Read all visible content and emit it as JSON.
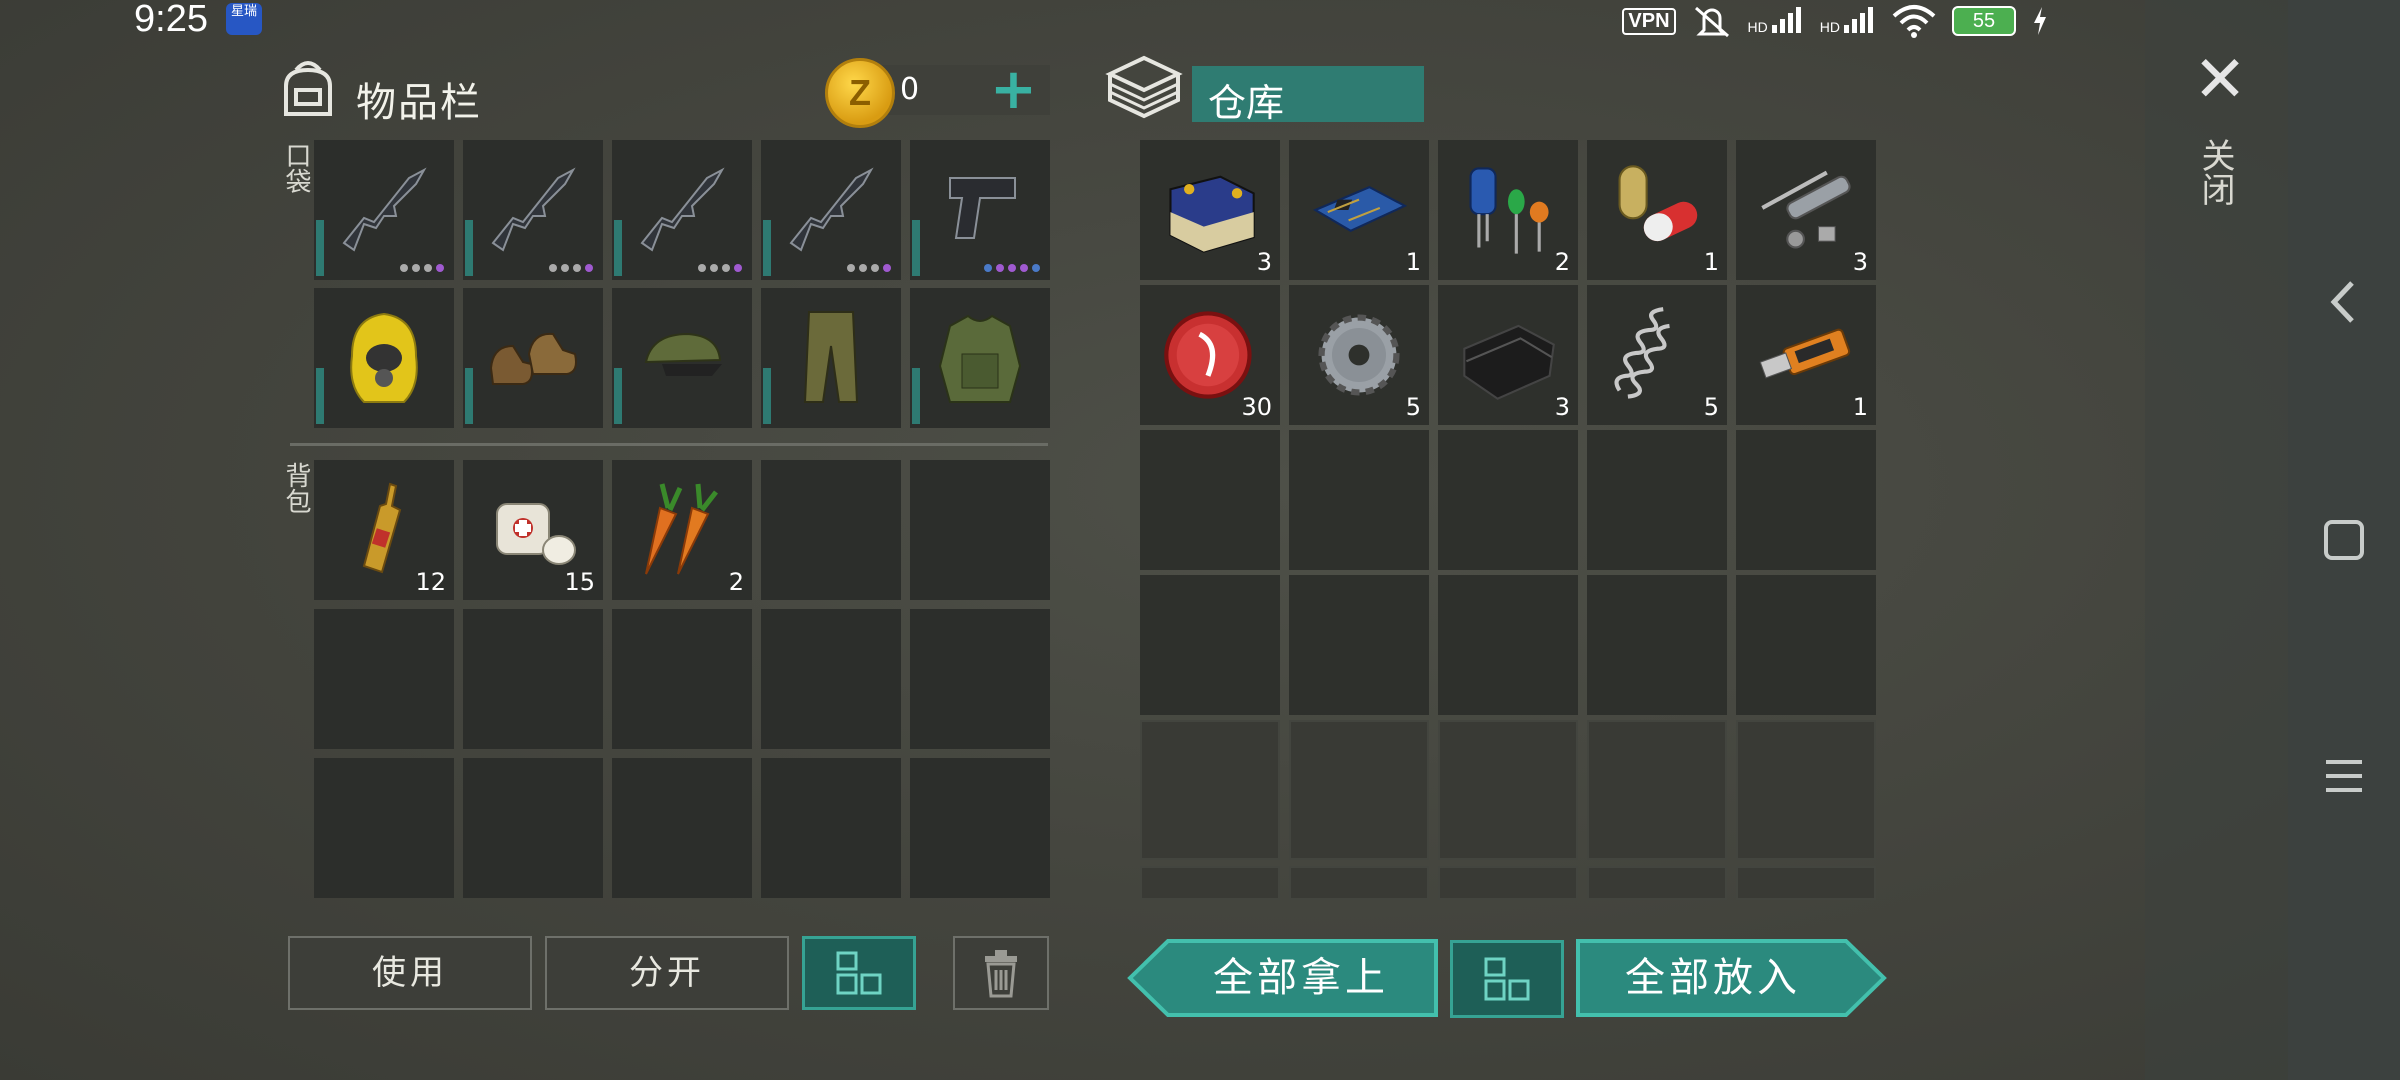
{
  "status_bar": {
    "time": "9:25",
    "app_badge": "星瑞",
    "vpn": "VPN",
    "signal1": "HD",
    "signal2": "HD",
    "battery": "55"
  },
  "inventory": {
    "title": "物品栏",
    "coins": "0",
    "pocket_label": "口袋",
    "backpack_label": "背包",
    "pocket_items": [
      {
        "icon": "assault-rifle-icon"
      },
      {
        "icon": "assault-rifle-icon"
      },
      {
        "icon": "assault-rifle-icon"
      },
      {
        "icon": "assault-rifle-icon"
      },
      {
        "icon": "pistol-icon"
      },
      {
        "icon": "hazmat-hood-icon"
      },
      {
        "icon": "boots-icon"
      },
      {
        "icon": "camo-cap-icon"
      },
      {
        "icon": "camo-pants-icon"
      },
      {
        "icon": "tactical-vest-icon"
      }
    ],
    "backpack_items": [
      {
        "icon": "ampoule-icon",
        "count": "12"
      },
      {
        "icon": "bandage-icon",
        "count": "15"
      },
      {
        "icon": "carrot-icon",
        "count": "2"
      }
    ]
  },
  "storage": {
    "title": "仓库",
    "close_label": "关闭",
    "items": [
      {
        "icon": "car-battery-icon",
        "count": "3"
      },
      {
        "icon": "circuit-board-icon",
        "count": "1"
      },
      {
        "icon": "electronic-components-icon",
        "count": "2"
      },
      {
        "icon": "capsule-icon",
        "count": "1"
      },
      {
        "icon": "metal-pipe-parts-icon",
        "count": "3"
      },
      {
        "icon": "bottle-cap-icon",
        "count": "30"
      },
      {
        "icon": "gear-icon",
        "count": "5"
      },
      {
        "icon": "leather-icon",
        "count": "3"
      },
      {
        "icon": "spring-icon",
        "count": "5"
      },
      {
        "icon": "usb-drive-icon",
        "count": "1"
      }
    ]
  },
  "buttons": {
    "use": "使用",
    "split": "分开",
    "take_all": "全部拿上",
    "put_all": "全部放入"
  },
  "colors": {
    "accent": "#2b8a7e",
    "accent_light": "#43c0ad",
    "slot_bg": "#2c2e2b",
    "coin": "#f0b820"
  }
}
